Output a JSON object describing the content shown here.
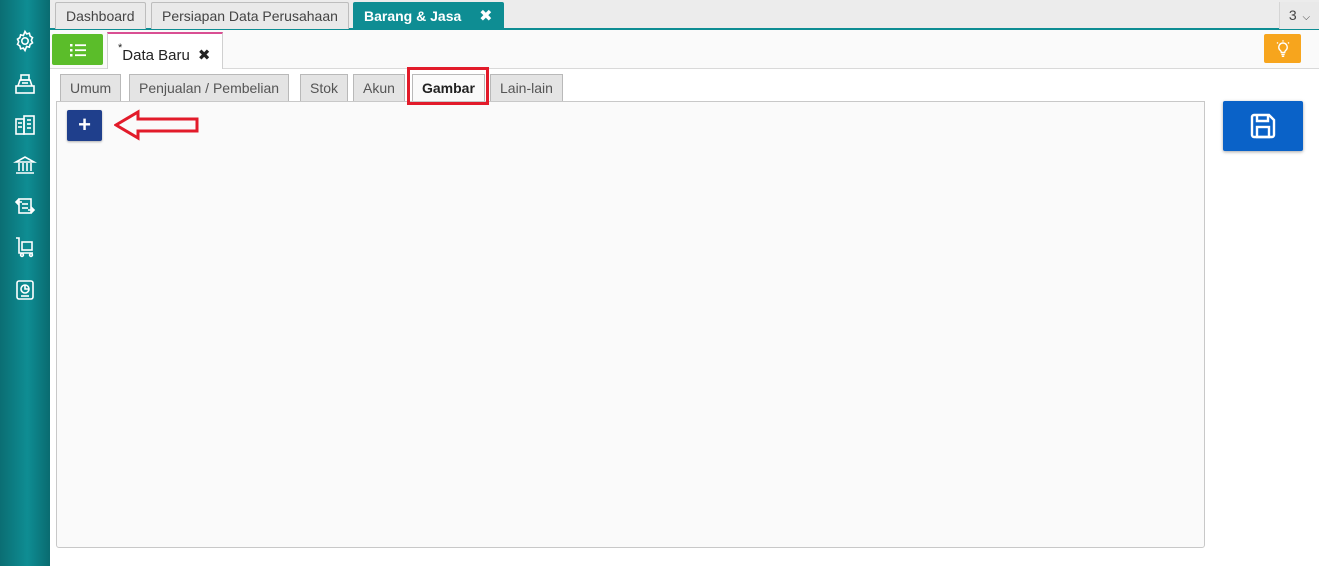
{
  "top_tabs": [
    {
      "label": "Dashboard"
    },
    {
      "label": "Persiapan Data Perusahaan"
    },
    {
      "label": "Barang & Jasa",
      "close": "✖"
    }
  ],
  "tab_count": "3",
  "tab_count_chevron": "⌵",
  "doc_tab": {
    "marker": "*",
    "label": "Data Baru",
    "close": "✖"
  },
  "inner_tabs": [
    {
      "label": "Umum"
    },
    {
      "label": "Penjualan / Pembelian"
    },
    {
      "label": "Stok"
    },
    {
      "label": "Akun"
    },
    {
      "label": "Gambar"
    },
    {
      "label": "Lain-lain"
    }
  ],
  "active_inner_tab": "Gambar",
  "add_button": {
    "label": "+"
  },
  "sidebar": {
    "icons": [
      "gear-icon",
      "cash-register-icon",
      "building-icon",
      "bank-icon",
      "transfer-icon",
      "cart-icon",
      "report-icon"
    ]
  },
  "colors": {
    "sidebar": "#0e8d93",
    "active_tab": "#0e8d93",
    "list_button": "#5bbd2a",
    "bulb_button": "#f7a51d",
    "add_button": "#1f3f8c",
    "save_button": "#0a62c8",
    "highlight": "#e21b2a"
  }
}
